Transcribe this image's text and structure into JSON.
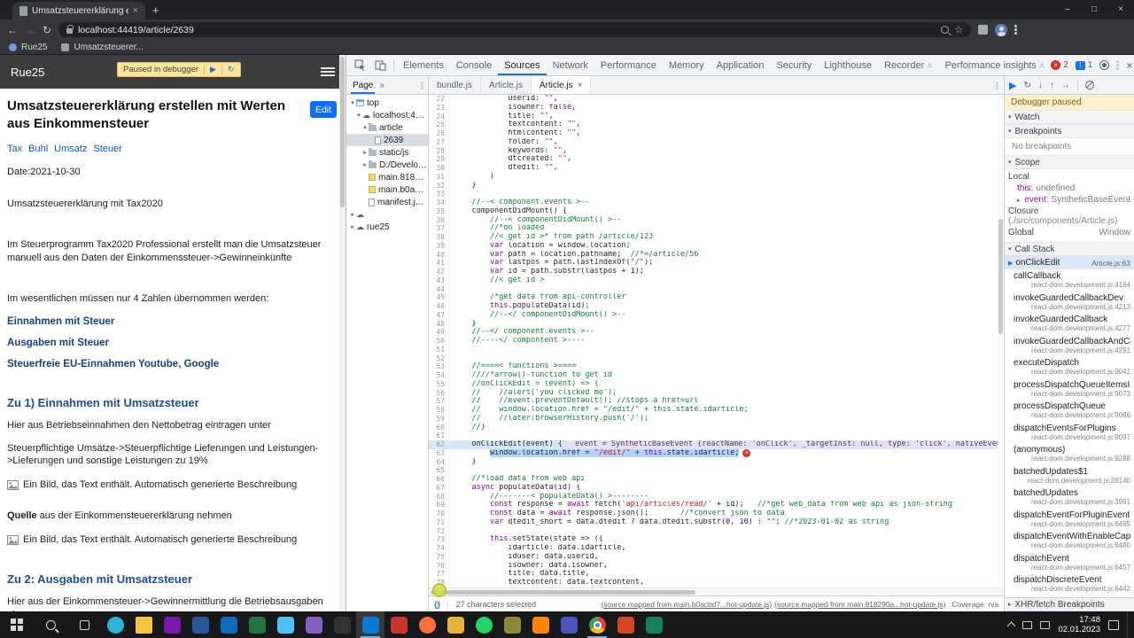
{
  "icons": {
    "play": "▶",
    "step_over": "↻",
    "step_into": "↓",
    "step_out": "↑",
    "step": "→",
    "chev_down": "▾",
    "chev_right": "▸",
    "menu": "≡",
    "close": "×",
    "minimize": "–",
    "maximize": "□",
    "back": "←",
    "forward": "→",
    "reload": "↻",
    "star": "☆",
    "warn": "⚠",
    "more": "»",
    "cloud": "☁",
    "new_tab": "+",
    "sep": "│",
    "err": "×",
    "issue": "!"
  },
  "browser": {
    "tab_title": "Umsatzsteuererklärung erst...",
    "url": "localhost:44419/article/2639",
    "bookmarks": [
      "Rue25",
      "Umsatzsteuerer..."
    ]
  },
  "page": {
    "site_title": "Rue25",
    "paused_badge": "Paused in debugger",
    "heading": "Umsatzsteuererklärung erstellen mit Werten aus Einkommensteuer",
    "edit_button": "Edit",
    "blocks": [
      {
        "type": "tags",
        "items": [
          "Tax",
          "Buhl",
          "Umsatz",
          "Steuer"
        ]
      },
      {
        "type": "p",
        "text": "Date:2021-10-30"
      },
      {
        "type": "p",
        "text": "Umsatzsteuererklärung mit Tax2020",
        "gap": "lg"
      },
      {
        "type": "p",
        "text": "Im Steuerprogramm Tax2020 Professional erstellt man die Umsatzsteuer manuell aus den Daten der Einkommenssteuer->Gewinneinkünfte",
        "gap": "xl"
      },
      {
        "type": "p",
        "text": "Im wesentlichen müssen nur 4 Zahlen übernommen werden:",
        "gap": "xl"
      },
      {
        "type": "sub",
        "text": "Einnahmen mit Steuer"
      },
      {
        "type": "sub",
        "text": "Ausgaben mit Steuer"
      },
      {
        "type": "sub",
        "text": "Steuerfreie EU-Einnahmen Youtube, Google"
      },
      {
        "type": "h2",
        "text": "Zu 1) Einnahmen mit Umsatzsteuer"
      },
      {
        "type": "p",
        "text": "Hier aus Betriebseinnahmen den Nettobetrag eintragen unter"
      },
      {
        "type": "p",
        "text": "Steuerpflichtige Umsätze->Steuerpflichtige Lieferungen und Leistungen->Lieferungen und sonstige Leistungen zu 19%"
      },
      {
        "type": "imgalt",
        "text": "Ein Bild, das Text enthält. Automatisch generierte Beschreibung"
      },
      {
        "type": "leadp",
        "lead": "Quelle",
        "text": " aus der Einkommensteuererklärung nehmen",
        "gap": "lg"
      },
      {
        "type": "imgalt",
        "text": "Ein Bild, das Text enthält. Automatisch generierte Beschreibung"
      },
      {
        "type": "h2",
        "text": "Zu 2: Ausgaben mit Umsatzsteuer",
        "gap": "xl"
      },
      {
        "type": "p",
        "text": "Hier aus der Einkommensteuer->Gewinnermittlung die Betriebsausgaben eintragen"
      }
    ]
  },
  "devtools": {
    "tabs": [
      {
        "label": "Elements"
      },
      {
        "label": "Console"
      },
      {
        "label": "Sources",
        "active": true
      },
      {
        "label": "Network"
      },
      {
        "label": "Performance"
      },
      {
        "label": "Memory"
      },
      {
        "label": "Application"
      },
      {
        "label": "Security"
      },
      {
        "label": "Lighthouse"
      },
      {
        "label": "Recorder",
        "warn": true
      },
      {
        "label": "Performance insights",
        "warn": true
      }
    ],
    "error_count": "2",
    "issue_count": "1",
    "navigator": {
      "tab": "Page",
      "tree": [
        {
          "label": "top",
          "depth": 0,
          "icon": "frame",
          "arrow": "open"
        },
        {
          "label": "localhost:4441",
          "depth": 1,
          "icon": "cloud",
          "arrow": "open"
        },
        {
          "label": "article",
          "depth": 2,
          "icon": "folder",
          "arrow": "open"
        },
        {
          "label": "2639",
          "depth": 3,
          "icon": "doc",
          "selected": true
        },
        {
          "label": "static/js",
          "depth": 2,
          "icon": "folder",
          "arrow": "closed"
        },
        {
          "label": "D:/Developm",
          "depth": 2,
          "icon": "folder",
          "arrow": "closed"
        },
        {
          "label": "main.81829...",
          "depth": 2,
          "icon": "js"
        },
        {
          "label": "main.b0acb...",
          "depth": 2,
          "icon": "js"
        },
        {
          "label": "manifest.json",
          "depth": 2,
          "icon": "doc"
        },
        {
          "label": "",
          "depth": 0,
          "icon": "cloud",
          "arrow": "closed"
        },
        {
          "label": "rue25",
          "depth": 0,
          "icon": "cloud",
          "arrow": "closed"
        }
      ]
    },
    "editor": {
      "tabs": [
        {
          "label": "bundle.js"
        },
        {
          "label": "Article.js"
        },
        {
          "label": "Article.js",
          "active": true
        }
      ],
      "paused_line": 62,
      "selected_line": 63,
      "inline_eval": "event = SyntheticBaseEvent {reactName: 'onClick', _targetInst: null, type: 'click', nativeEvent: PointerEvent",
      "lines": [
        {
          "n": 22,
          "t": "            userid: \"\","
        },
        {
          "n": 23,
          "t": "            isowner: false,"
        },
        {
          "n": 24,
          "t": "            title: \"\","
        },
        {
          "n": 25,
          "t": "            textcontent: \"\","
        },
        {
          "n": 26,
          "t": "            htmlcontent: \"\","
        },
        {
          "n": 27,
          "t": "            folder: \"\","
        },
        {
          "n": 28,
          "t": "            keywords: \"\","
        },
        {
          "n": 29,
          "t": "            dtcreated: \"\","
        },
        {
          "n": 30,
          "t": "            dtedit: \"\","
        },
        {
          "n": 31,
          "t": "        )"
        },
        {
          "n": 32,
          "t": "    }"
        },
        {
          "n": 33,
          "t": ""
        },
        {
          "n": 34,
          "t": "    //--< component.events >--"
        },
        {
          "n": 35,
          "t": "    componentDidMount() {"
        },
        {
          "n": 36,
          "t": "        //--< componentDidMount() >--"
        },
        {
          "n": 37,
          "t": "        //*on loaded"
        },
        {
          "n": 38,
          "t": "        //< get id >* from path /article/123"
        },
        {
          "n": 39,
          "t": "        var location = window.location;"
        },
        {
          "n": 40,
          "t": "        var path = location.pathname;  //*=/article/56"
        },
        {
          "n": 41,
          "t": "        var lastpos = path.lastIndexOf(\"/\");"
        },
        {
          "n": 42,
          "t": "        var id = path.substr(lastpos + 1);"
        },
        {
          "n": 43,
          "t": "        //< get id >"
        },
        {
          "n": 44,
          "t": ""
        },
        {
          "n": 45,
          "t": "        /*get data from api-controller"
        },
        {
          "n": 46,
          "t": "        this.populateData(id);"
        },
        {
          "n": 47,
          "t": "        //--</ componentDidMount() >--"
        },
        {
          "n": 48,
          "t": "    }"
        },
        {
          "n": 49,
          "t": "    //--</ component.events >--"
        },
        {
          "n": 50,
          "t": "    //----</ compontent >----"
        },
        {
          "n": 51,
          "t": ""
        },
        {
          "n": 52,
          "t": ""
        },
        {
          "n": 53,
          "t": "    //====< functions >===="
        },
        {
          "n": 54,
          "t": "    ////*arrow()-function to get id"
        },
        {
          "n": 55,
          "t": "    //onClickEdit = (event) => {"
        },
        {
          "n": 56,
          "t": "    //    //alert('you clicked me');"
        },
        {
          "n": 57,
          "t": "    //    //event.preventDefault(); //stops a href=url"
        },
        {
          "n": 58,
          "t": "    //    window.location.href = \"/edit/\" + this.state.idarticle;"
        },
        {
          "n": 59,
          "t": "    //    //later:browserHistory.push('/');"
        },
        {
          "n": 60,
          "t": "    //}"
        },
        {
          "n": 61,
          "t": ""
        },
        {
          "n": 62,
          "t": "    onClickEdit(event) {"
        },
        {
          "n": 63,
          "t": "        window.location.href = \"/edit/\" + this.state.idarticle;"
        },
        {
          "n": 64,
          "t": "    }"
        },
        {
          "n": 65,
          "t": ""
        },
        {
          "n": 66,
          "t": "    //*load data from web api"
        },
        {
          "n": 67,
          "t": "    async populateData(id) {"
        },
        {
          "n": 68,
          "t": "        //-------< populateData() >--------"
        },
        {
          "n": 69,
          "t": "        const response = await fetch('api/articles/read/' + id);   //*get web_data from web api as json-string"
        },
        {
          "n": 70,
          "t": "        const data = await response.json();       //*convert json to data"
        },
        {
          "n": 71,
          "t": "        var dtedit_short = data.dtedit ? data.dtedit.substr(0, 10) : \"\"; //*2023-01-02 as string"
        },
        {
          "n": 72,
          "t": ""
        },
        {
          "n": 73,
          "t": "        this.setState(state => ({"
        },
        {
          "n": 74,
          "t": "            idarticle: data.idarticle,"
        },
        {
          "n": 75,
          "t": "            iduser: data.userid,"
        },
        {
          "n": 76,
          "t": "            isowner: data.isowner,"
        },
        {
          "n": 77,
          "t": "            title: data.title,"
        },
        {
          "n": 78,
          "t": "            textcontent: data.textcontent,"
        }
      ],
      "pretty_print": "{}",
      "status_left": "27 characters selected",
      "status_maps": [
        "(source mapped from main.b0acbd7...hot-update.js)",
        "(source mapped from main.818290a...hot-update.js)"
      ],
      "coverage": "Coverage: n/a"
    },
    "dbg": {
      "banner": "Debugger paused",
      "watch_label": "Watch",
      "breakpoints_label": "Breakpoints",
      "no_breakpoints": "No breakpoints",
      "scope_label": "Scope",
      "callstack_label": "Call Stack",
      "xhr_label": "XHR/fetch Breakpoints",
      "scope": {
        "local": "Local",
        "this_name": "this:",
        "this_val": "undefined",
        "event_name": "event:",
        "event_val": "SyntheticBaseEvent {",
        "closure": "Closure",
        "closure_path": "(./src/components/Article.js)",
        "global": "Global",
        "global_val": "Window"
      },
      "callstack": [
        {
          "name": "onClickEdit",
          "loc": "Article.js:63",
          "active": true
        },
        {
          "name": "callCallback",
          "loc": "react-dom.development.js:4164"
        },
        {
          "name": "invokeGuardedCallbackDev",
          "loc": "react-dom.development.js:4213"
        },
        {
          "name": "invokeGuardedCallback",
          "loc": "react-dom.development.js:4277"
        },
        {
          "name": "invokeGuardedCallbackAndCa...",
          "loc": "react-dom.development.js:4291"
        },
        {
          "name": "executeDispatch",
          "loc": "react-dom.development.js:9041"
        },
        {
          "name": "processDispatchQueueItemsIn...",
          "loc": "react-dom.development.js:9073"
        },
        {
          "name": "processDispatchQueue",
          "loc": "react-dom.development.js:9086"
        },
        {
          "name": "dispatchEventsForPlugins",
          "loc": "react-dom.development.js:9097"
        },
        {
          "name": "(anonymous)",
          "loc": "react-dom.development.js:9288"
        },
        {
          "name": "batchedUpdates$1",
          "loc": "react-dom.development.js:26140"
        },
        {
          "name": "batchedUpdates",
          "loc": "react-dom.development.js:3991"
        },
        {
          "name": "dispatchEventForPluginEventS...",
          "loc": "react-dom.development.js:6465"
        },
        {
          "name": "dispatchEventWithEnableCapt...",
          "loc": "react-dom.development.js:6480"
        },
        {
          "name": "dispatchEvent",
          "loc": "react-dom.development.js:6457"
        },
        {
          "name": "dispatchDiscreteEvent",
          "loc": "react-dom.development.js:6442"
        }
      ]
    }
  },
  "taskbar": {
    "clock_time": "17:48",
    "clock_date": "02.01.2023",
    "apps": [
      {
        "name": "edge",
        "color": "#2bb3d8",
        "shape": "circle"
      },
      {
        "name": "file-explorer",
        "color": "#f5c542",
        "shape": "folder"
      },
      {
        "name": "onenote",
        "color": "#7719aa"
      },
      {
        "name": "word",
        "color": "#2b579a"
      },
      {
        "name": "mail",
        "color": "#0f6cbd"
      },
      {
        "name": "excel",
        "color": "#217346"
      },
      {
        "name": "photos",
        "color": "#4fc3f7"
      },
      {
        "name": "visual-studio",
        "color": "#865fc5"
      },
      {
        "name": "terminal",
        "color": "#333333"
      },
      {
        "name": "vscode",
        "color": "#0a7bd4",
        "open": true,
        "focused": true
      },
      {
        "name": "keepass",
        "color": "#c8372d"
      },
      {
        "name": "firefox",
        "color": "#ff7139",
        "shape": "circle"
      },
      {
        "name": "paint",
        "color": "#e8b339"
      },
      {
        "name": "whatsapp",
        "color": "#25d366",
        "shape": "circle"
      },
      {
        "name": "notepad",
        "color": "#8a8a3a"
      },
      {
        "name": "vlc",
        "color": "#ff8800"
      },
      {
        "name": "teams",
        "color": "#4b53bc"
      },
      {
        "name": "chrome",
        "color": "#e8453c",
        "shape": "chrome",
        "open": true
      },
      {
        "name": "powerpoint",
        "color": "#d24726"
      },
      {
        "name": "sharex",
        "color": "#12805c"
      }
    ]
  }
}
